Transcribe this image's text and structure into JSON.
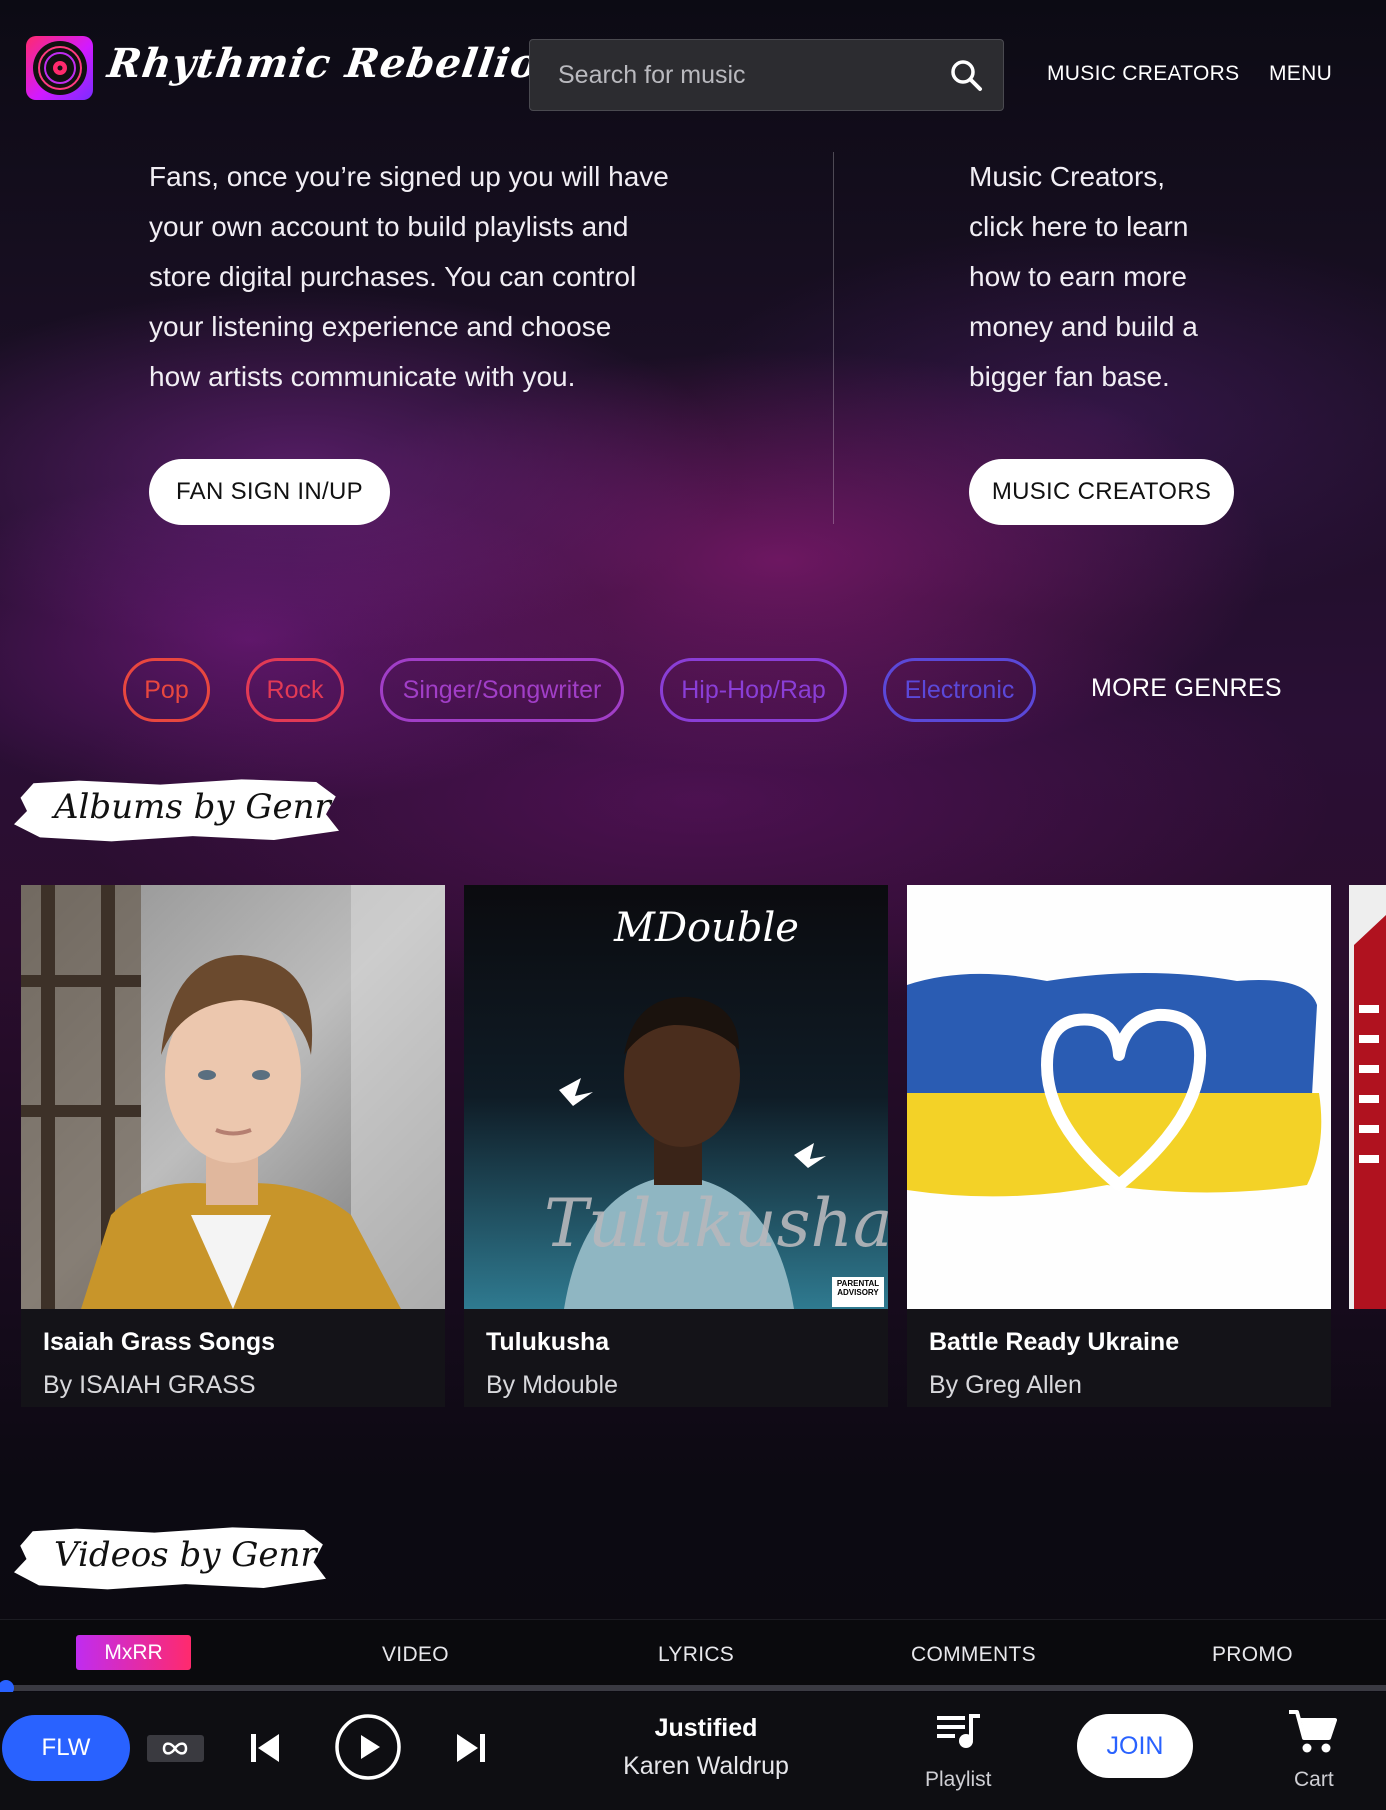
{
  "header": {
    "logo_text": "Rhythmic Rebellion",
    "search_placeholder": "Search for music",
    "nav": {
      "music_creators": "MUSIC CREATORS",
      "menu": "MENU"
    }
  },
  "hero": {
    "fans_lines": [
      "Fans, once you’re signed up you will have",
      "your own account to build playlists and",
      "store digital purchases. You can control",
      "your listening experience and choose",
      "how artists communicate with you."
    ],
    "creators_lines": [
      "Music Creators,",
      "click here to learn",
      "how to earn more",
      "money and build a",
      "bigger fan base."
    ],
    "fan_button": "FAN SIGN IN/UP",
    "creators_button": "MUSIC CREATORS"
  },
  "genres": {
    "items": [
      {
        "label": "Pop",
        "color": "#e8473f"
      },
      {
        "label": "Rock",
        "color": "#e23a55"
      },
      {
        "label": "Singer/Songwriter",
        "color": "#a13ec7"
      },
      {
        "label": "Hip-Hop/Rap",
        "color": "#8a3ed6"
      },
      {
        "label": "Electronic",
        "color": "#5b48d8"
      }
    ],
    "more": "MORE GENRES"
  },
  "sections": {
    "albums_heading": "Albums by Genre",
    "videos_heading": "Videos by Genre"
  },
  "albums": [
    {
      "title": "Isaiah Grass Songs",
      "artist": "By ISAIAH GRASS"
    },
    {
      "title": "Tulukusha",
      "artist": "By Mdouble",
      "art_text_top": "MDouble",
      "art_text_main": "Tulukusha",
      "art_badge": "PARENTAL ADVISORY"
    },
    {
      "title": "Battle Ready Ukraine",
      "artist": "By Greg Allen"
    }
  ],
  "player": {
    "tabs": {
      "mxrr": "MxRR",
      "video": "VIDEO",
      "lyrics": "LYRICS",
      "comments": "COMMENTS",
      "promo": "PROMO"
    },
    "progress": 0,
    "flw": "FLW",
    "song_title": "Justified",
    "song_artist": "Karen Waldrup",
    "playlist": "Playlist",
    "join": "JOIN",
    "cart": "Cart"
  },
  "colors": {
    "accent_blue": "#2962ff",
    "brand_pink": "#ff2a6d",
    "brand_purple": "#c02cf0"
  }
}
